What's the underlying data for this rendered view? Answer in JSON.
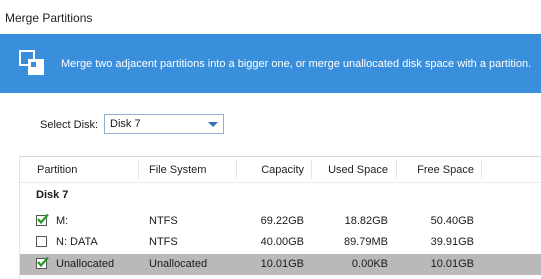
{
  "window": {
    "title": "Merge Partitions"
  },
  "banner": {
    "description": "Merge two adjacent partitions into a bigger one, or merge unallocated disk space with a partition.",
    "icon": "merge-partitions-icon",
    "background": "#3a8fdc"
  },
  "disk_select": {
    "label": "Select Disk:",
    "value": "Disk 7"
  },
  "table": {
    "columns": [
      "Partition",
      "File System",
      "Capacity",
      "Used Space",
      "Free Space"
    ],
    "group": "Disk 7",
    "rows": [
      {
        "checked": true,
        "partition": "M:",
        "file_system": "NTFS",
        "capacity": "69.22GB",
        "used": "18.82GB",
        "free": "50.40GB",
        "selected": false
      },
      {
        "checked": false,
        "partition": "N: DATA",
        "file_system": "NTFS",
        "capacity": "40.00GB",
        "used": "89.79MB",
        "free": "39.91GB",
        "selected": false
      },
      {
        "checked": true,
        "partition": "Unallocated",
        "file_system": "Unallocated",
        "capacity": "10.01GB",
        "used": "0.00KB",
        "free": "10.01GB",
        "selected": true
      }
    ]
  }
}
